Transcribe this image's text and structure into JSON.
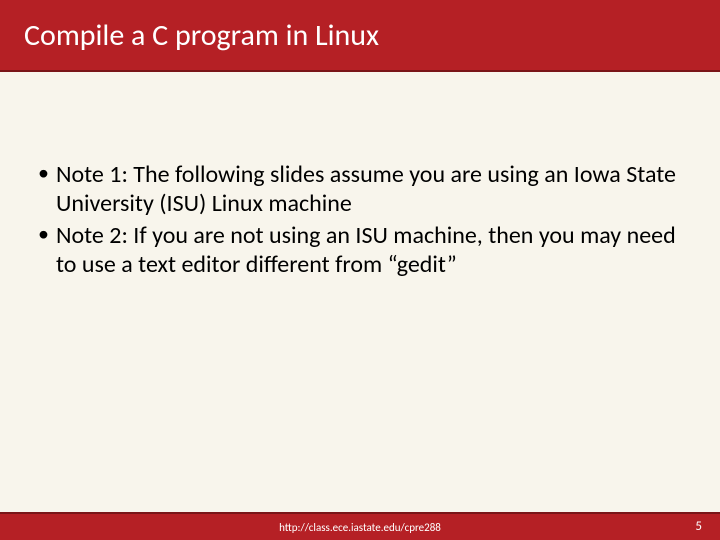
{
  "slide": {
    "title": "Compile a C program in Linux",
    "bullets": [
      "Note 1: The following slides assume you are using an Iowa State University (ISU) Linux machine",
      "Note 2: If you are not using an ISU machine, then you may need to use a text editor different from “gedit”"
    ],
    "footer_url": "http://class.ece.iastate.edu/cpre288",
    "page_number": "5"
  }
}
